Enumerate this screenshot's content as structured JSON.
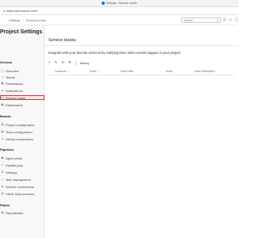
{
  "browser": {
    "window_title": "Settings - Service hooks",
    "url": "https://dev.azure.com/"
  },
  "header": {
    "breadcrumbs": [
      "Settings",
      "Service hooks"
    ],
    "search_placeholder": "Search"
  },
  "sidebar": {
    "title": "Project Settings",
    "sections": [
      {
        "heading": "General",
        "items": [
          {
            "label": "Overview",
            "icon": "info-icon"
          },
          {
            "label": "Teams",
            "icon": "team-icon"
          },
          {
            "label": "Permissions",
            "icon": "lock-icon"
          },
          {
            "label": "Notifications",
            "icon": "bell-icon"
          },
          {
            "label": "Service hooks",
            "icon": "hook-icon",
            "active": true
          },
          {
            "label": "Dashboards",
            "icon": "dashboard-icon"
          }
        ]
      },
      {
        "heading": "Boards",
        "items": [
          {
            "label": "Project configuration",
            "icon": "config-icon"
          },
          {
            "label": "Team configuration",
            "icon": "team-config-icon"
          },
          {
            "label": "GitHub connections",
            "icon": "github-icon"
          }
        ]
      },
      {
        "heading": "Pipelines",
        "items": [
          {
            "label": "Agent pools",
            "icon": "agent-pool-icon"
          },
          {
            "label": "Parallel jobs",
            "icon": "parallel-icon"
          },
          {
            "label": "Settings",
            "icon": "gear-icon"
          },
          {
            "label": "Test management",
            "icon": "test-icon"
          },
          {
            "label": "Service connections",
            "icon": "connection-icon"
          },
          {
            "label": "XAML build services",
            "icon": "build-icon"
          }
        ]
      },
      {
        "heading": "Repos",
        "items": [
          {
            "label": "Repositories",
            "icon": "repo-icon"
          }
        ]
      }
    ]
  },
  "main": {
    "title": "Service Hooks",
    "description": "Integrate with your favorite services by notifying them when events happen in your project.",
    "toolbar": {
      "history_label": "History"
    },
    "table": {
      "columns": [
        "Consumer",
        "Event",
        "Event Filter",
        "Action",
        "Action Description"
      ]
    }
  },
  "colors": {
    "accent": "#0078d4",
    "active_outline": "#d9313a",
    "add_green": "#2e8b3a",
    "delete_red": "#c83232"
  }
}
